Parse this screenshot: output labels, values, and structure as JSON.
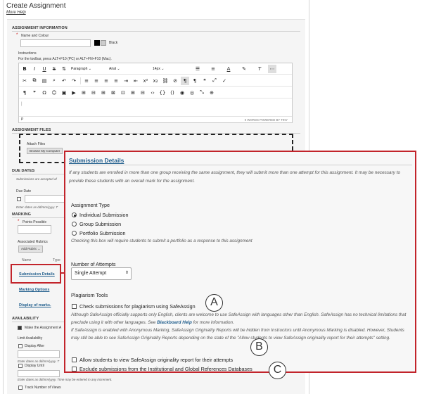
{
  "page": {
    "title": "Create Assignment",
    "help_link": "More Help"
  },
  "assignment_info": {
    "header": "ASSIGNMENT INFORMATION",
    "name_label": "Name and Colour",
    "colour_value": "Black",
    "instructions_label": "Instructions",
    "toolbar_hint": "For the toolbar, press ALT+F10 (PC) or ALT+FN+F10 (Mac).",
    "paragraph_select": "Paragraph",
    "font_select": "Arial",
    "size_select": "14px",
    "editor_path": "P",
    "word_count": "0 WORDS  POWERED BY TINY"
  },
  "assignment_files": {
    "header": "ASSIGNMENT FILES",
    "attach_label": "Attach Files",
    "browse_button": "Browse My Computer"
  },
  "due_dates": {
    "header": "DUE DATES",
    "note": "Submissions are accepted af",
    "due_date_label": "Due Date",
    "date_hint": "Enter dates as dd/mm/yyyy. T"
  },
  "marking": {
    "header": "MARKING",
    "points_label": "Points Possible",
    "rubrics_label": "Associated Rubrics",
    "add_rubric_button": "Add Rubric",
    "col_name": "Name",
    "col_type": "Type",
    "submission_details_link": "Submission Details",
    "marking_options_link": "Marking Options",
    "display_of_marks_link": "Display of marks."
  },
  "availability": {
    "header": "AVAILABILITY",
    "make_available": "Make the Assignment A",
    "limit_availability": "Limit Availability",
    "display_after": "Display After",
    "date_hint_1": "Enter dates as dd/mm/yyyy. T",
    "display_until": "Display Until",
    "date_hint_2": "Enter dates as dd/mm/yyyy. Time may be entered in any increment.",
    "track_views": "Track Number of Views"
  },
  "submission_details": {
    "header": "Submission Details",
    "description": "If any students are enrolled in more than one group receiving the same assignment, they will submit more than one attempt for this assignment. It may be necessary to provide these students with an overall mark for the assignment.",
    "assignment_type_label": "Assignment Type",
    "type_options": [
      "Individual Submission",
      "Group Submission",
      "Portfolio Submission"
    ],
    "selected_type": "Individual Submission",
    "portfolio_note": "Checking this box will require students to submit a portfolio as a response to this assignment",
    "attempts_label": "Number of Attempts",
    "attempts_value": "Single Attempt",
    "plagiarism_label": "Plagiarism Tools",
    "check_safeassign": "Check submissions for plagiarism using SafeAssign",
    "safeassign_note_pre": "Although SafeAssign officially supports only English, clients are welcome to use SafeAssign with languages other than English. SafeAssign has no technical limitations that preclude using it with other languages. See ",
    "safeassign_help_link": "Blackboard Help",
    "safeassign_note_post": " for more information.",
    "anonymous_note": "If SafeAssign is enabled with Anonymous Marking, SafeAssign Originality Reports will be hidden from Instructors until Anonymous Marking is disabled. However, Students may still be able to see SafeAssign Originality Reports depending on the state of the \"Allow students to view SafeAssign originality report for their attempts\" setting.",
    "allow_view_report": "Allow students to view SafeAssign originality report for their attempts",
    "exclude_submissions": "Exclude submissions from the Institutional and Global References Databases"
  },
  "callouts": [
    "A",
    "B",
    "C"
  ],
  "colors": {
    "highlight": "#c2242b",
    "link": "#1f5d8c"
  }
}
